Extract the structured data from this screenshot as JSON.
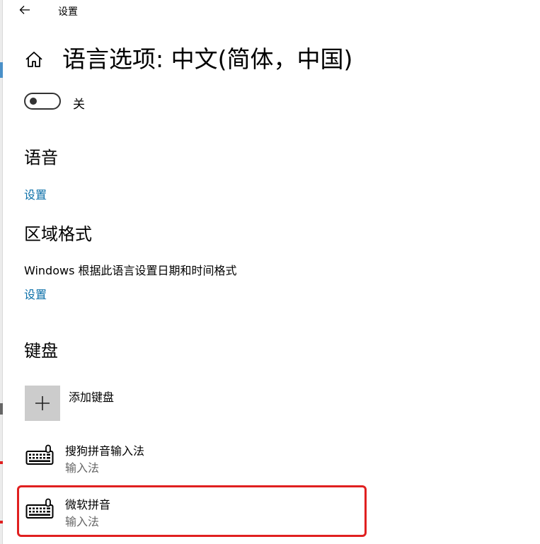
{
  "window": {
    "title": "设置"
  },
  "header": {
    "page_title": "语言选项: 中文(简体，中国)"
  },
  "toggle": {
    "state_label": "关",
    "checked": false
  },
  "speech": {
    "heading": "语音",
    "link": "设置"
  },
  "region": {
    "heading": "区域格式",
    "description": "Windows 根据此语言设置日期和时间格式",
    "link": "设置"
  },
  "keyboard": {
    "heading": "键盘",
    "add_label": "添加键盘",
    "items": [
      {
        "name": "搜狗拼音输入法",
        "type": "输入法"
      },
      {
        "name": "微软拼音",
        "type": "输入法"
      }
    ]
  },
  "colors": {
    "accent_link": "#0a6fa8",
    "highlight": "#e02020",
    "tile": "#cccccc",
    "secondary_text": "#666666"
  }
}
